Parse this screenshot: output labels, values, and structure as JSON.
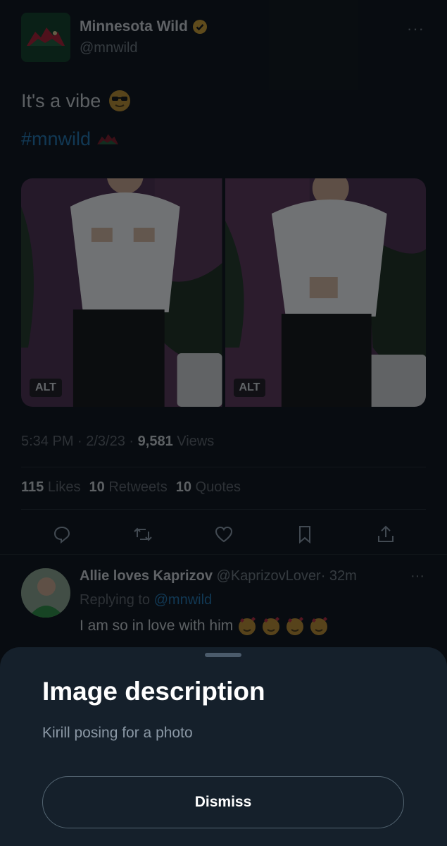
{
  "tweet": {
    "author_name": "Minnesota Wild",
    "author_handle": "@mnwild",
    "more_label": "···",
    "text": "It's a vibe",
    "hashtag": "#mnwild",
    "media_alt_badges": [
      "ALT",
      "ALT"
    ],
    "timestamp": "5:34 PM · 2/3/23 · ",
    "views_count": "9,581",
    "views_label": " Views",
    "likes_count": "115",
    "likes_label": "Likes",
    "retweets_count": "10",
    "retweets_label": "Retweets",
    "quotes_count": "10",
    "quotes_label": "Quotes"
  },
  "actions": [
    "reply-icon",
    "retweet-icon",
    "like-icon",
    "bookmark-icon",
    "share-icon"
  ],
  "reply": {
    "name": "Allie loves Kaprizov",
    "handle": "@KaprizovLover",
    "time": "· 32m",
    "more_label": "···",
    "replying_prefix": "Replying to ",
    "replying_handle": "@mnwild",
    "text": "I am so in love with him"
  },
  "sheet": {
    "title": "Image description",
    "description": "Kirill posing for a photo",
    "dismiss_label": "Dismiss"
  },
  "colors": {
    "background": "#0b0f14",
    "sheet": "#15202b",
    "link": "#1d6fa8",
    "verified": "#c99a2e"
  }
}
